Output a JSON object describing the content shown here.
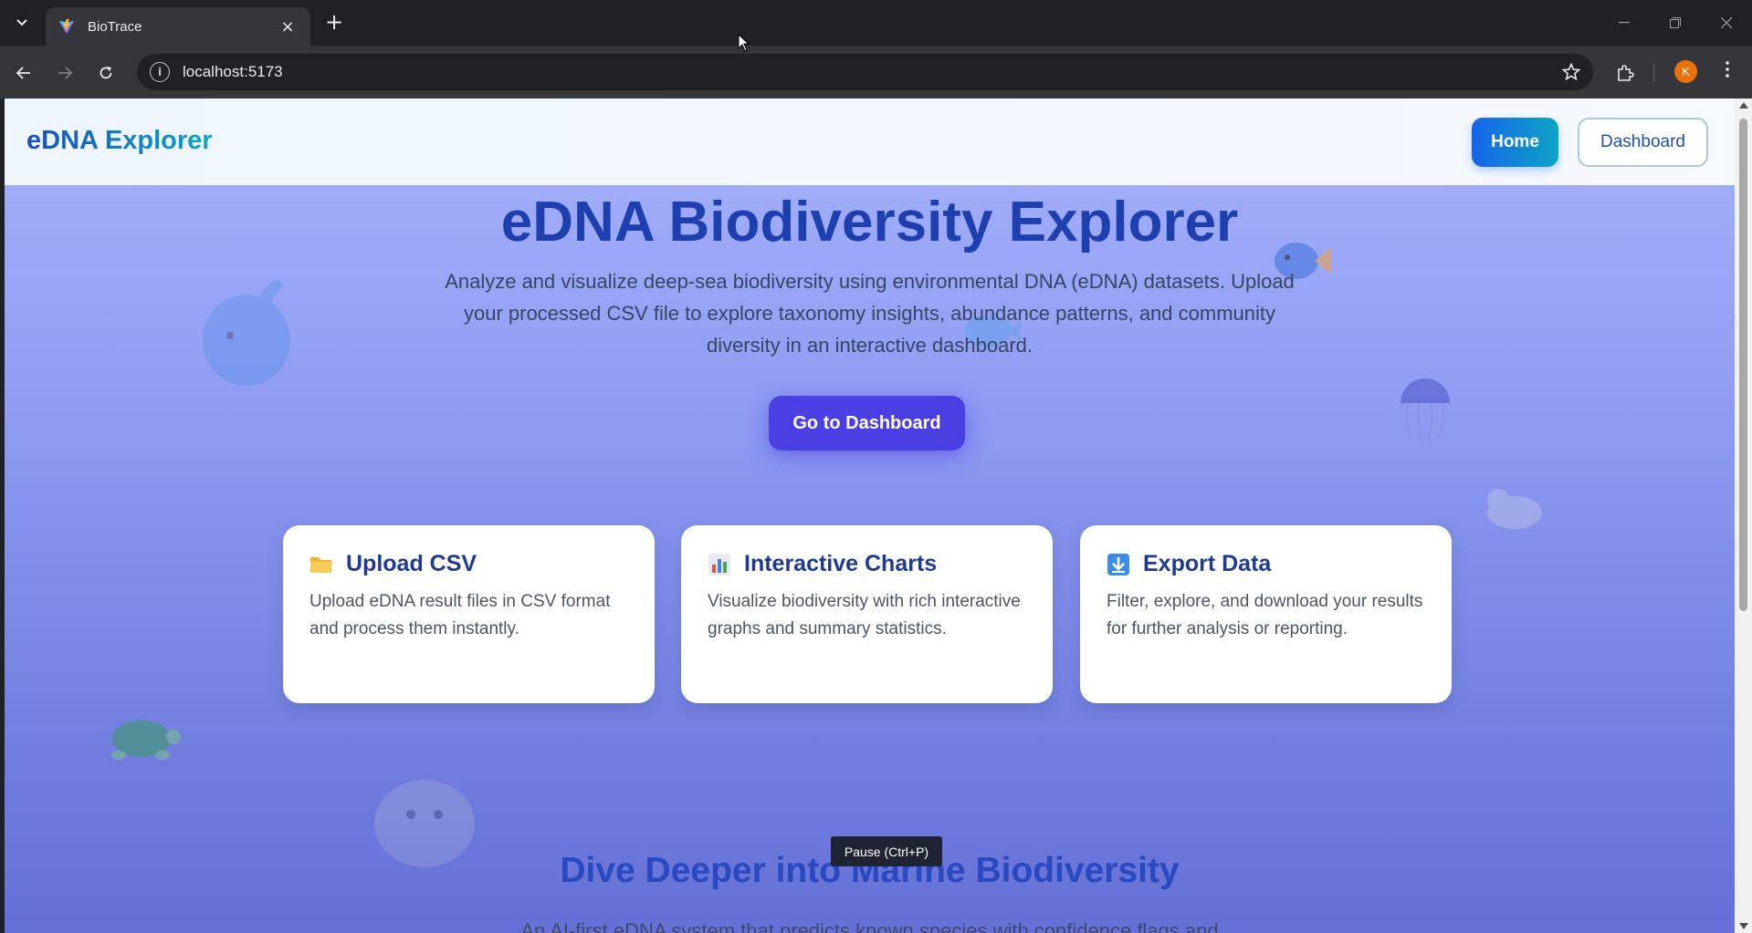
{
  "browser": {
    "tab_title": "BioTrace",
    "url": "localhost:5173",
    "profile_initial": "K",
    "new_tab_symbol": "+",
    "close_symbol": "×"
  },
  "navbar": {
    "brand": "eDNA Explorer",
    "home_label": "Home",
    "dashboard_label": "Dashboard"
  },
  "hero": {
    "title": "eDNA Biodiversity Explorer",
    "description": "Analyze and visualize deep-sea biodiversity using environmental DNA (eDNA) datasets. Upload your processed CSV file to explore taxonomy insights, abundance patterns, and community diversity in an interactive dashboard.",
    "cta_label": "Go to Dashboard"
  },
  "features": [
    {
      "icon": "folder-icon",
      "title": "Upload CSV",
      "text": "Upload eDNA result files in CSV format and process them instantly."
    },
    {
      "icon": "bar-chart-icon",
      "title": "Interactive Charts",
      "text": "Visualize biodiversity with rich interactive graphs and summary statistics."
    },
    {
      "icon": "download-icon",
      "title": "Export Data",
      "text": "Filter, explore, and download your results for further analysis or reporting."
    }
  ],
  "section": {
    "title": "Dive Deeper into Marine Biodiversity",
    "subtitle": "An AI-first eDNA system that predicts known species with confidence flags and"
  },
  "tooltip": "Pause (Ctrl+P)",
  "colors": {
    "brand_blue": "#1e3fae",
    "cta_purple": "#4a3fe3",
    "home_gradient_start": "#1664e8",
    "home_gradient_end": "#0ea5c6"
  }
}
